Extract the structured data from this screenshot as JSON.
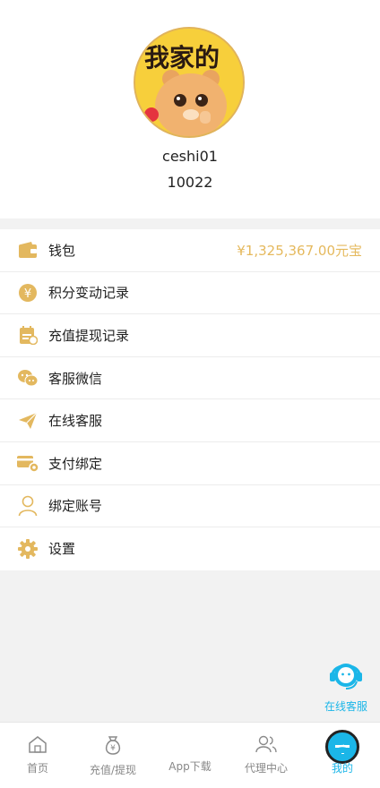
{
  "profile": {
    "avatar_text": "我家的",
    "username": "ceshi01",
    "user_id": "10022"
  },
  "menu": [
    {
      "label": "钱包",
      "value": "¥1,325,367.00元宝",
      "icon": "wallet-icon"
    },
    {
      "label": "积分变动记录",
      "icon": "yen-coin-icon"
    },
    {
      "label": "充值提现记录",
      "icon": "records-icon"
    },
    {
      "label": "客服微信",
      "icon": "wechat-icon"
    },
    {
      "label": "在线客服",
      "icon": "paper-plane-icon"
    },
    {
      "label": "支付绑定",
      "icon": "card-settings-icon"
    },
    {
      "label": "绑定账号",
      "icon": "user-icon"
    },
    {
      "label": "设置",
      "icon": "gear-icon"
    }
  ],
  "floating_service": {
    "label": "在线客服",
    "icon": "headset-icon"
  },
  "tabbar": [
    {
      "label": "首页",
      "icon": "home-icon"
    },
    {
      "label": "充值/提现",
      "icon": "money-bag-icon"
    },
    {
      "label": "App下载",
      "icon": "plus-icon"
    },
    {
      "label": "代理中心",
      "icon": "users-icon"
    },
    {
      "label": "我的",
      "icon": "person-icon",
      "active": true
    }
  ],
  "colors": {
    "accent": "#1bb6e8",
    "gold": "#e5b95d",
    "background": "#f2f2f2"
  }
}
